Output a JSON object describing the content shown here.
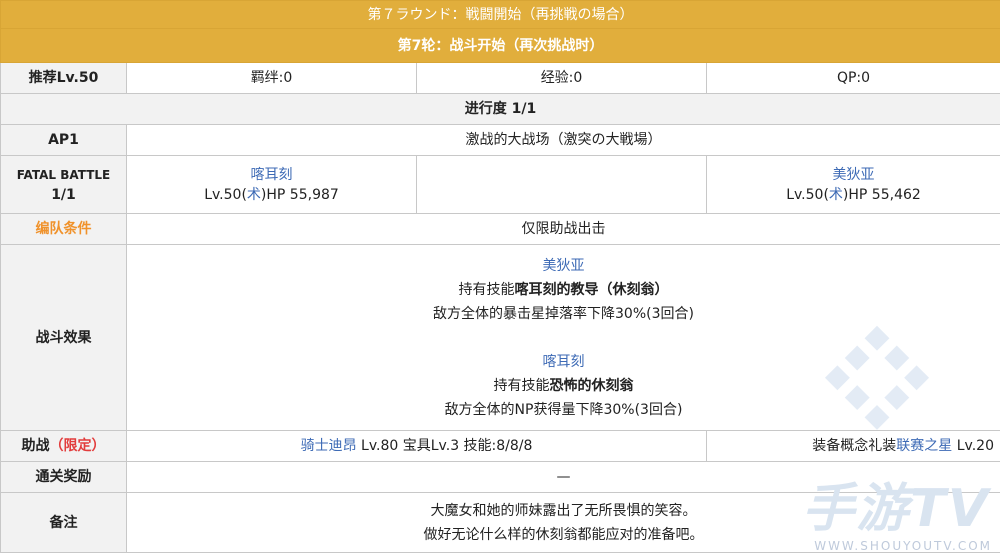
{
  "header": {
    "jp_title": "第７ラウンド：戦闘開始（再挑戦の場合）",
    "cn_title": "第7轮：战斗开始（再次挑战时）"
  },
  "summary": {
    "recommend": "推荐Lv.50",
    "bond": "羁绊:0",
    "exp": "经验:0",
    "qp": "QP:0"
  },
  "progress": "进行度 1/1",
  "ap": {
    "label": "AP1",
    "location": "激战的大战场（激突の大戦場）"
  },
  "fatal": {
    "label_line1": "FATAL BATTLE",
    "label_line2": "1/1",
    "enemy1_name": "喀耳刻",
    "enemy1_lv": "Lv.50(",
    "enemy1_class": "术",
    "enemy1_hp": ")HP 55,987",
    "enemy2_name": "美狄亚",
    "enemy2_lv": "Lv.50(",
    "enemy2_class": "术",
    "enemy2_hp": ")HP 55,462"
  },
  "formation": {
    "label": "编队条件",
    "value": "仅限助战出击"
  },
  "effects": {
    "label": "战斗效果",
    "e1_name": "美狄亚",
    "e1_prefix": "持有技能",
    "e1_skill": "喀耳刻的教导（休刻翁）",
    "e1_desc": "敌方全体的暴击星掉落率下降30%(3回合)",
    "e2_name": "喀耳刻",
    "e2_prefix": "持有技能",
    "e2_skill": "恐怖的休刻翁",
    "e2_desc": "敌方全体的NP获得量下降30%(3回合)"
  },
  "support": {
    "label_prefix": "助战",
    "label_limited": "（限定）",
    "servant_name": "骑士迪昂",
    "servant_info": " Lv.80 宝具Lv.3 技能:8/8/8",
    "ce_prefix": "装备概念礼装",
    "ce_name": "联赛之星",
    "ce_lv": " Lv.20"
  },
  "reward": {
    "label": "通关奖励",
    "value": "—"
  },
  "notes": {
    "label": "备注",
    "line1": "大魔女和她的师妹露出了无所畏惧的笑容。",
    "line2": "做好无论什么样的休刻翁都能应对的准备吧。"
  },
  "watermark": {
    "text": "手游TV",
    "url": "WWW.SHOUYOUTV.COM"
  },
  "colors": {
    "header_bg": "#e1ae3c",
    "label_bg": "#f2f2f2",
    "link_blue": "#3d6ab5",
    "orange": "#f0922b",
    "red": "#e23c3c"
  }
}
